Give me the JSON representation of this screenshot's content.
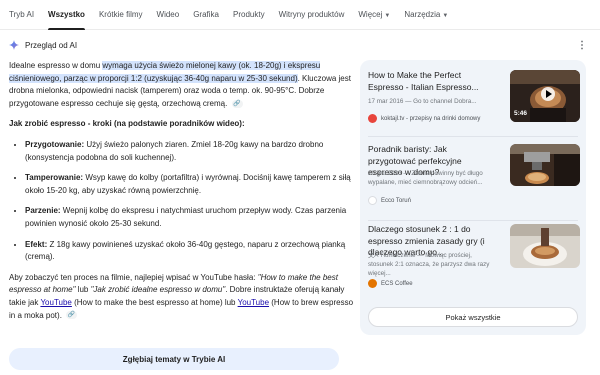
{
  "tabs": [
    {
      "label": "Tryb AI"
    },
    {
      "label": "Wszystko"
    },
    {
      "label": "Krótkie filmy"
    },
    {
      "label": "Wideo"
    },
    {
      "label": "Grafika"
    },
    {
      "label": "Produkty"
    },
    {
      "label": "Witryny produktów"
    },
    {
      "label": "Więcej"
    },
    {
      "label": "Narzędzia"
    }
  ],
  "ai_overview": {
    "title": "Przegląd od AI",
    "intro_a": "Idealne espresso w domu ",
    "intro_hl": "wymaga użycia świeżo mielonej kawy (ok. 18-20g) i ekspresu ciśnieniowego, parząc w proporcji 1:2 (uzyskując 36-40g naparu w 25-30 sekund)",
    "intro_b": ". Kluczowa jest drobna mielonka, odpowiedni nacisk (tamperem) oraz woda o temp. ok. 90-95°C. Dobrze przygotowane espresso cechuje się gęstą, orzechową cremą.",
    "heading": "Jak zrobić espresso - kroki (na podstawie poradników wideo):",
    "steps": [
      {
        "label": "Przygotowanie:",
        "text": " Użyj świeżo palonych ziaren. Zmiel 18-20g kawy na bardzo drobno (konsystencja podobna do soli kuchennej)."
      },
      {
        "label": "Tamperowanie:",
        "text": " Wsyp kawę do kolby (portafiltra) i wyrównaj. Dociśnij kawę tamperem z siłą około 15-20 kg, aby uzyskać równą powierzchnię."
      },
      {
        "label": "Parzenie:",
        "text": " Wepnij kolbę do ekspresu i natychmiast uruchom przepływ wody. Czas parzenia powinien wynosić około 25-30 sekund."
      },
      {
        "label": "Efekt:",
        "text": " Z 18g kawy powinieneś uzyskać około 36-40g gęstego, naparu z orzechową pianką (cremą)."
      }
    ],
    "yt_a": "Aby zobaczyć ten proces na filmie, najlepiej wpisać w YouTube hasła: ",
    "yt_q1": "\"How to make the best espresso at home\"",
    "yt_b": " lub ",
    "yt_q2": "\"Jak zrobić idealne espresso w domu\"",
    "yt_c": ". Dobre instruktaże oferują kanały takie jak ",
    "yt_link1": "YouTube",
    "yt_d": " (How to make the best espresso at home) lub ",
    "yt_link2": "YouTube",
    "yt_e": " (How to brew espresso in a moka pot).",
    "explore_button": "Zgłębiaj tematy w Trybie AI"
  },
  "sources": [
    {
      "title": "How to Make the Perfect Espresso - Italian Espresso...",
      "meta": "17 mar 2016 — Go to channel Dobra...",
      "site": "koktajl.tv - przepisy na drinki domowy",
      "duration": "5:46"
    },
    {
      "title": "Poradnik baristy: Jak przygotować perfekcyjne espresso w domu?",
      "meta": "20 gru 2023 — Ziarna powinny być długo wypalane, mieć ciemnobrązowy odcień...",
      "site": "Ecco Toruń"
    },
    {
      "title": "Dlaczego stosunek 2 : 1 do espresso zmienia zasady gry (i dlaczego warto go...",
      "meta": "Tłumaczenie — Mówiąc prościej, stosunek 2:1 oznacza, że parzysz dwa razy więcej...",
      "site": "ECS Coffee"
    }
  ],
  "show_all": "Pokaż wszystkie",
  "colors": {
    "highlight": "#d3e3fd",
    "panel": "#f0f4f9",
    "link": "#1a0dab",
    "accent": "#1a73e8"
  }
}
